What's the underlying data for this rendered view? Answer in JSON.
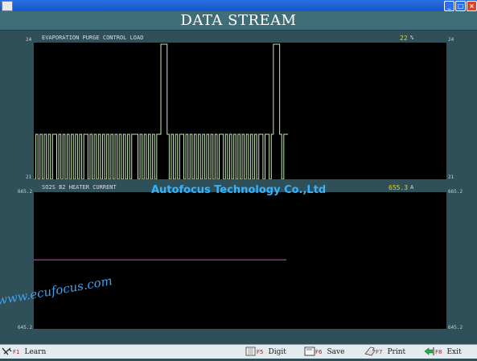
{
  "window": {
    "min_glyph": "_",
    "max_glyph": "□",
    "close_glyph": "×"
  },
  "header": {
    "title": "DATA STREAM"
  },
  "watermark": "Autofocus Technology Co.,Ltd",
  "website": "www.ecufocus.com",
  "charts": [
    {
      "title": "EVAPORATION PURGE CONTROL LOAD",
      "value": "22",
      "unit": "%",
      "ymax_label": "24",
      "ymin_label": "21",
      "ymax_label_right": "24",
      "ymin_label_right": "21",
      "color": "#c4e8b5"
    },
    {
      "title": "SO2S B2 HEATER CURRENT",
      "value": "655.3",
      "unit": "A",
      "ymax_label": "665.2",
      "ymin_label": "645.2",
      "ymax_label_right": "665.2",
      "ymin_label_right": "645.2",
      "color": "#d050d8"
    }
  ],
  "chart_data": [
    {
      "type": "line",
      "title": "EVAPORATION PURGE CONTROL LOAD",
      "ylim": [
        21,
        24
      ],
      "series": [
        {
          "name": "EVAPORATION PURGE CONTROL LOAD",
          "values": [
            21,
            22,
            21,
            22,
            21,
            22,
            21,
            22,
            21,
            22,
            22,
            21,
            22,
            21,
            22,
            21,
            22,
            21,
            22,
            21,
            22,
            21,
            22,
            21,
            22,
            22,
            21,
            22,
            21,
            22,
            21,
            22,
            21,
            22,
            21,
            22,
            21,
            22,
            21,
            22,
            21,
            22,
            21,
            22,
            21,
            22,
            21,
            22,
            22,
            22,
            21,
            22,
            21,
            22,
            21,
            22,
            21,
            22,
            21,
            22,
            22,
            24,
            24,
            24,
            22,
            21,
            22,
            21,
            22,
            21,
            22,
            22,
            21,
            22,
            21,
            22,
            21,
            22,
            21,
            22,
            21,
            22,
            21,
            22,
            21,
            22,
            21,
            22,
            21,
            22,
            22,
            21,
            22,
            21,
            22,
            21,
            22,
            21,
            22,
            21,
            22,
            21,
            22,
            21,
            22,
            21,
            22,
            21,
            22,
            22,
            21,
            22,
            22,
            21,
            22,
            24,
            24,
            24,
            22,
            21,
            22,
            22
          ]
        }
      ]
    },
    {
      "type": "line",
      "title": "SO2S B2 HEATER CURRENT",
      "ylim": [
        645.2,
        665.2
      ],
      "series": [
        {
          "name": "SO2S B2 HEATER CURRENT",
          "values": [
            655.3,
            655.3,
            655.3,
            655.3,
            655.3,
            655.3,
            655.3,
            655.3,
            655.3,
            655.3,
            655.3,
            655.3,
            655.3,
            655.3,
            655.3,
            655.3,
            655.3,
            655.3,
            655.3,
            655.3,
            655.3,
            655.3,
            655.3,
            655.3,
            655.3
          ]
        }
      ]
    }
  ],
  "fkeys": [
    {
      "key": "F1",
      "label": "Learn",
      "icon": "learn-icon"
    },
    {
      "key": "F5",
      "label": "Digit",
      "icon": "digit-icon"
    },
    {
      "key": "F6",
      "label": "Save",
      "icon": "save-icon"
    },
    {
      "key": "F7",
      "label": "Print",
      "icon": "print-icon"
    },
    {
      "key": "F8",
      "label": "Exit",
      "icon": "exit-icon"
    }
  ]
}
